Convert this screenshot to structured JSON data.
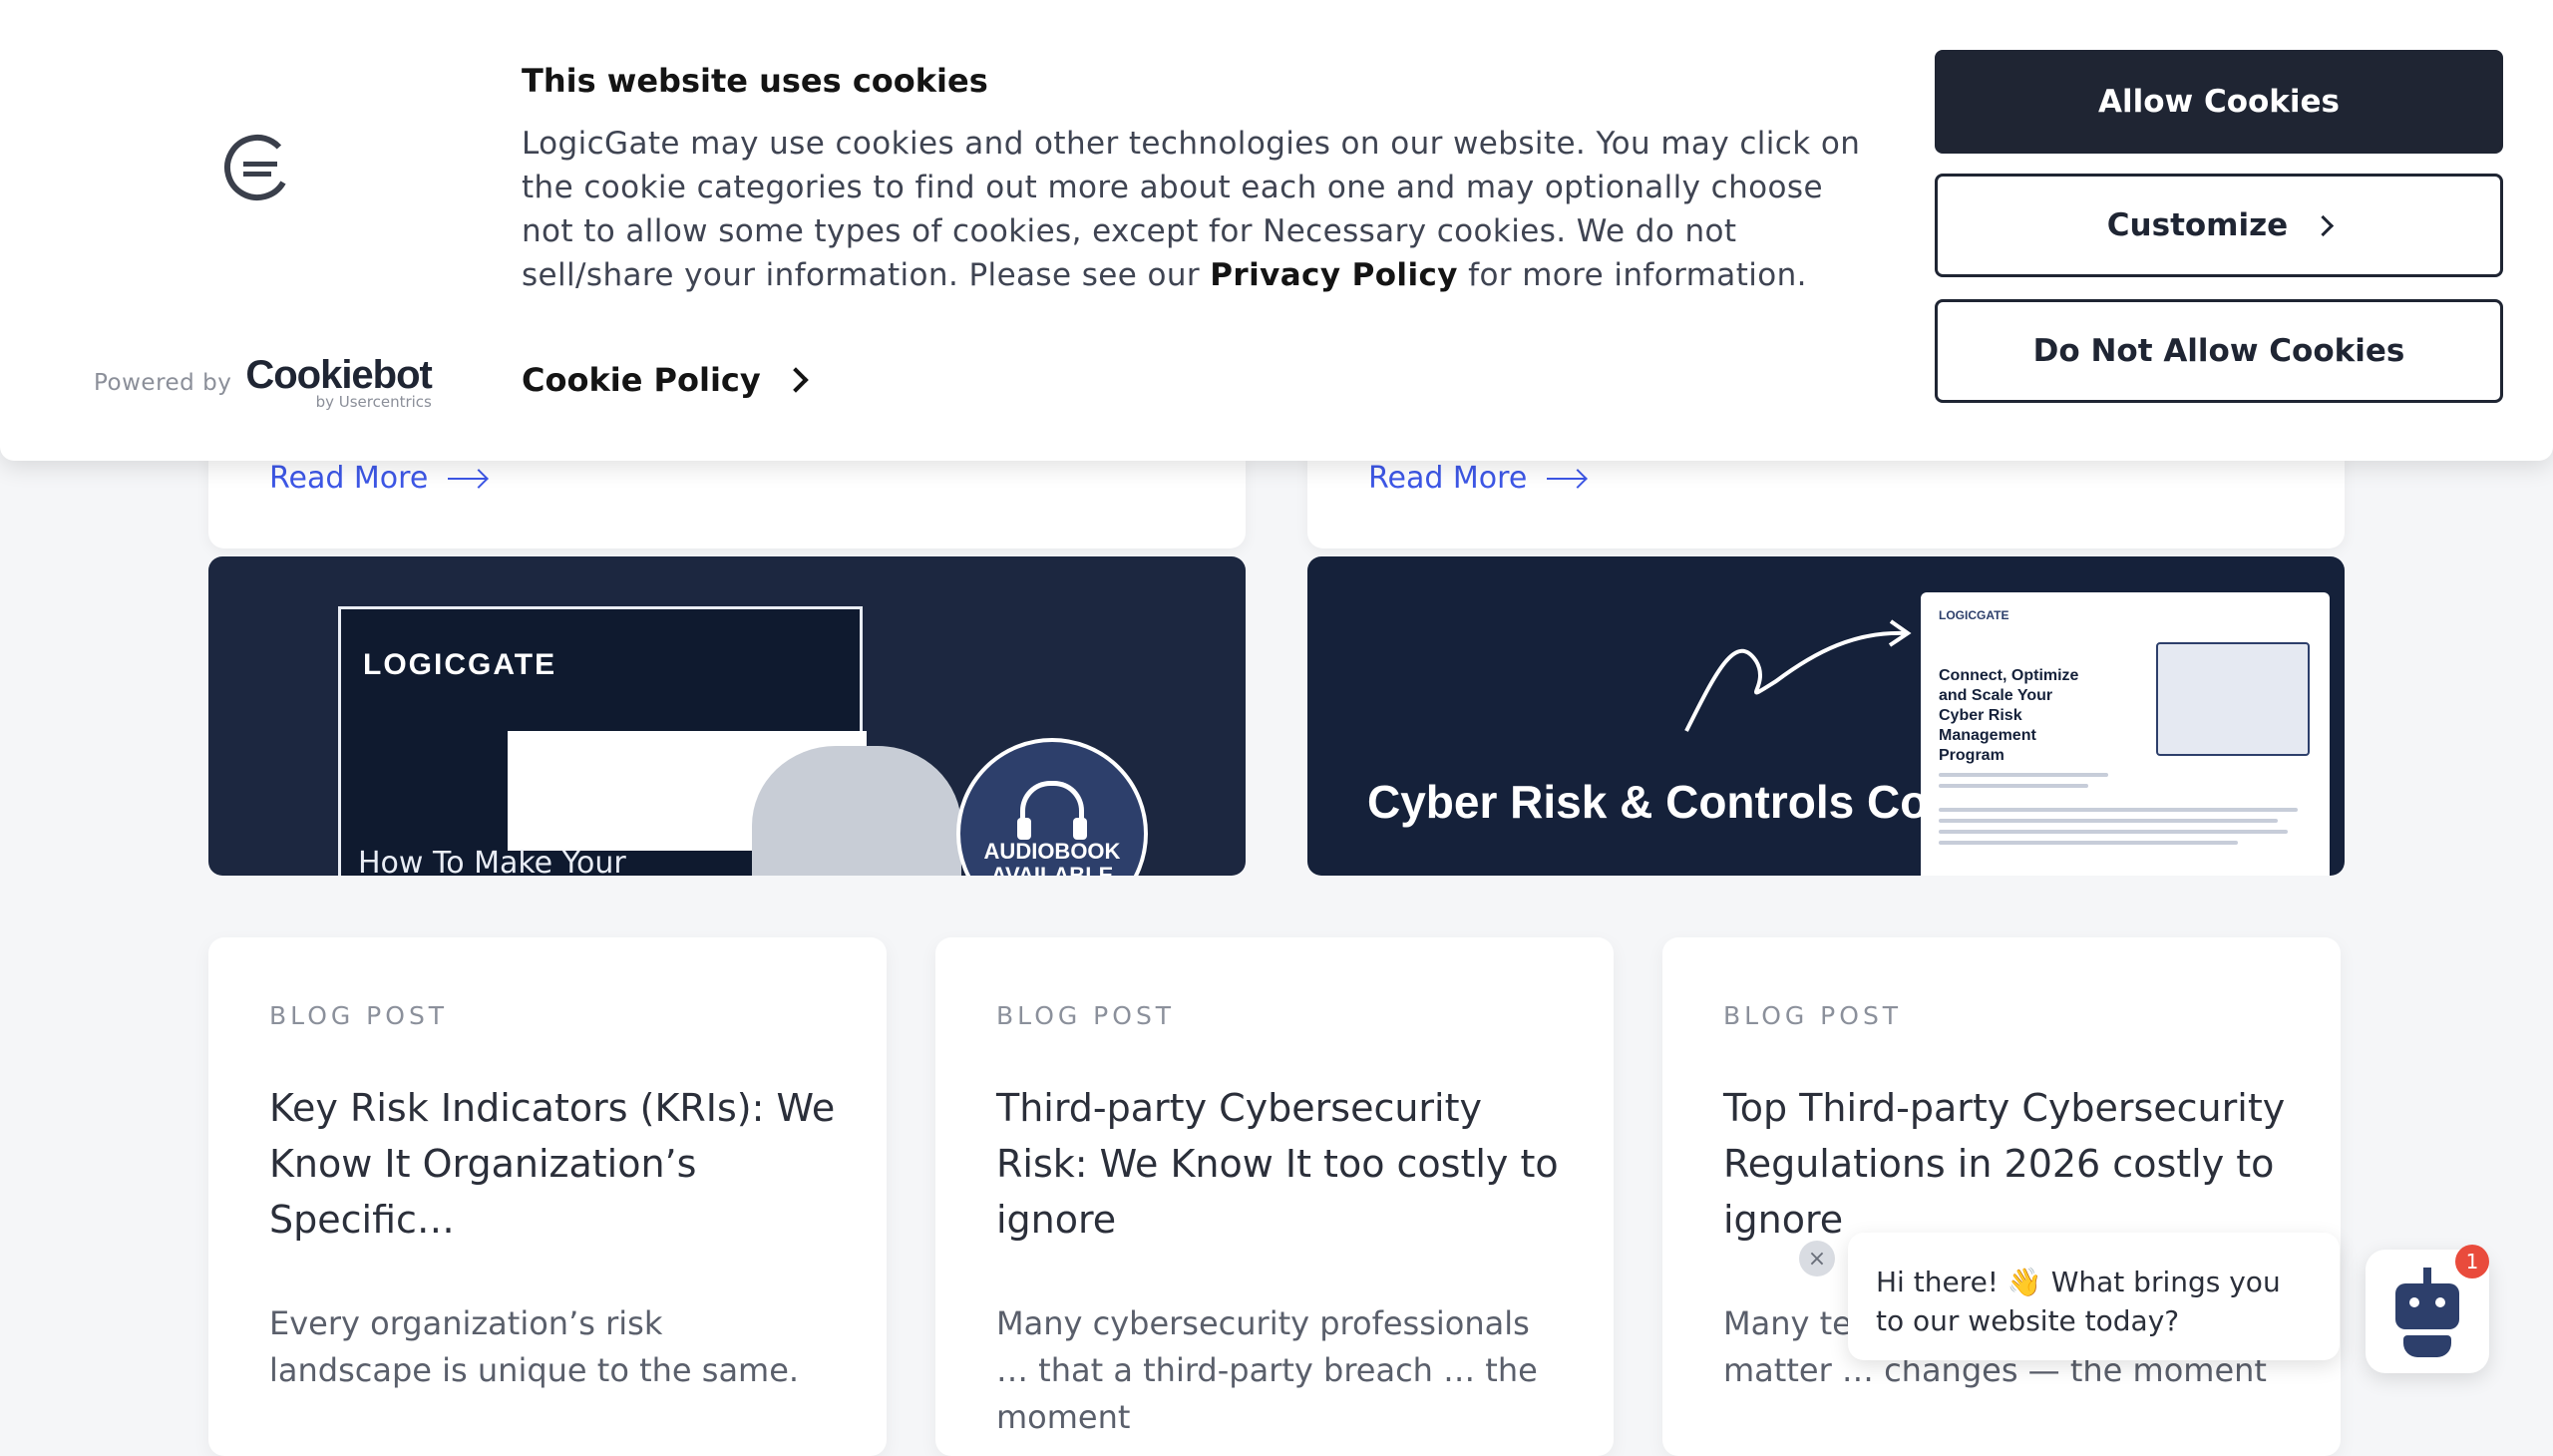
{
  "cookie_banner": {
    "title": "This website uses cookies",
    "body_before_link": "LogicGate may use cookies and other technologies on our website. You may click on the cookie categories to find out more about each one and may optionally choose not to allow some types of cookies, except for Necessary cookies.  We do not sell/share your information. Please see our ",
    "privacy_link": "Privacy Policy",
    "body_after_link": " for more information.",
    "cookie_policy_link": "Cookie Policy",
    "powered_by": "Powered by",
    "cookiebot_name": "Cookiebot",
    "cookiebot_sub": "by Usercentrics",
    "buttons": {
      "allow": "Allow Cookies",
      "customize": "Customize",
      "deny": "Do Not Allow Cookies"
    }
  },
  "blog": {
    "read_more": "Read More",
    "promos": [
      {
        "brand": "LOGICGATE",
        "title": "How To Make Your",
        "badge": "AUDIOBOOK AVAILABLE"
      },
      {
        "title": "Cyber Risk & Controls Compliance Solution",
        "doc_brand": "LOGICGATE",
        "doc_heading": "Connect, Optimize and Scale Your Cyber Risk Management Program"
      }
    ],
    "cards": [
      {
        "label": "BLOG POST",
        "title": "Key Risk Indicators (KRIs): We Know It Organization’s Specific…",
        "excerpt": "Every organization’s risk landscape is unique to the same."
      },
      {
        "label": "BLOG POST",
        "title": "Third-party Cybersecurity Risk: We Know It too costly to ignore",
        "excerpt": "Many cybersecurity professionals … that a third-party breach … the moment"
      },
      {
        "label": "BLOG POST",
        "title": "Top Third-party Cybersecurity Regulations in 2026 costly to ignore",
        "excerpt": "Many teams have experienced … matter … changes — the moment"
      }
    ]
  },
  "chat": {
    "greeting": "Hi there! 👋 What brings you to our website today?",
    "unread_count": "1",
    "close_symbol": "×"
  }
}
